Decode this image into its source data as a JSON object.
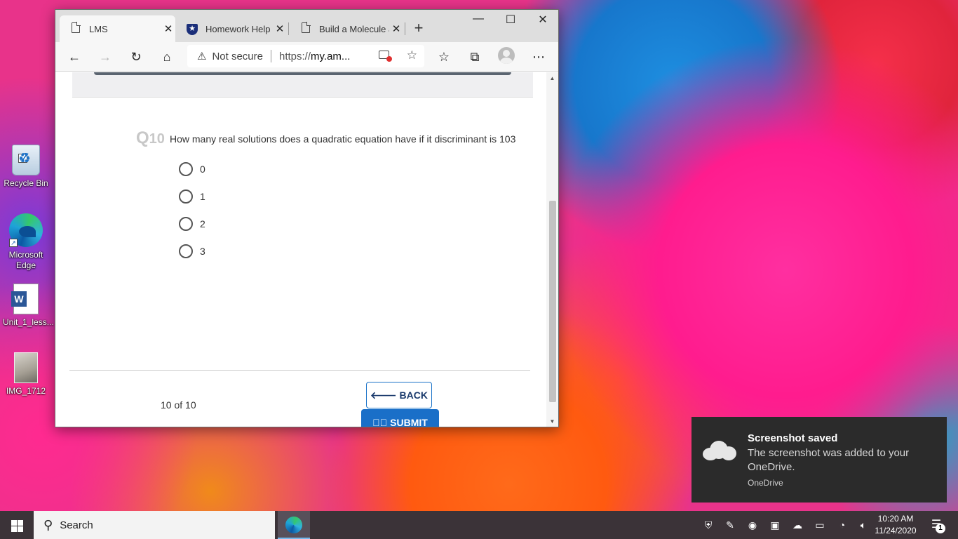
{
  "desktop": {
    "icons": [
      {
        "label": "Recycle Bin"
      },
      {
        "label": "Microsoft Edge"
      },
      {
        "label": "Unit_1_less..."
      },
      {
        "label": "IMG_1712"
      }
    ]
  },
  "browser": {
    "tabs": [
      {
        "label": "LMS",
        "icon": "page-icon",
        "active": true
      },
      {
        "label": "Homework Help -",
        "icon": "shield-star-icon",
        "active": false
      },
      {
        "label": "Build a Molecule a",
        "icon": "page-icon",
        "active": false
      }
    ],
    "new_tab_label": "+",
    "address": {
      "security": "Not secure",
      "url_prefix": "https://",
      "url_host": "my.am..."
    },
    "window_controls": {
      "minimize": "—",
      "maximize": "☐",
      "close": "✕"
    }
  },
  "quiz": {
    "q_letter": "Q",
    "q_number": "10",
    "question": "How many real solutions does a quadratic equation have if it discriminant is 103",
    "options": [
      "0",
      "1",
      "2",
      "3"
    ],
    "progress": "10 of 10",
    "back_label": "BACK",
    "submit_label": "SUBMIT"
  },
  "toast": {
    "title": "Screenshot saved",
    "body": "The screenshot was added to your OneDrive.",
    "app": "OneDrive"
  },
  "taskbar": {
    "search_placeholder": "Search",
    "time": "10:20 AM",
    "date": "11/24/2020",
    "notification_count": "1"
  }
}
